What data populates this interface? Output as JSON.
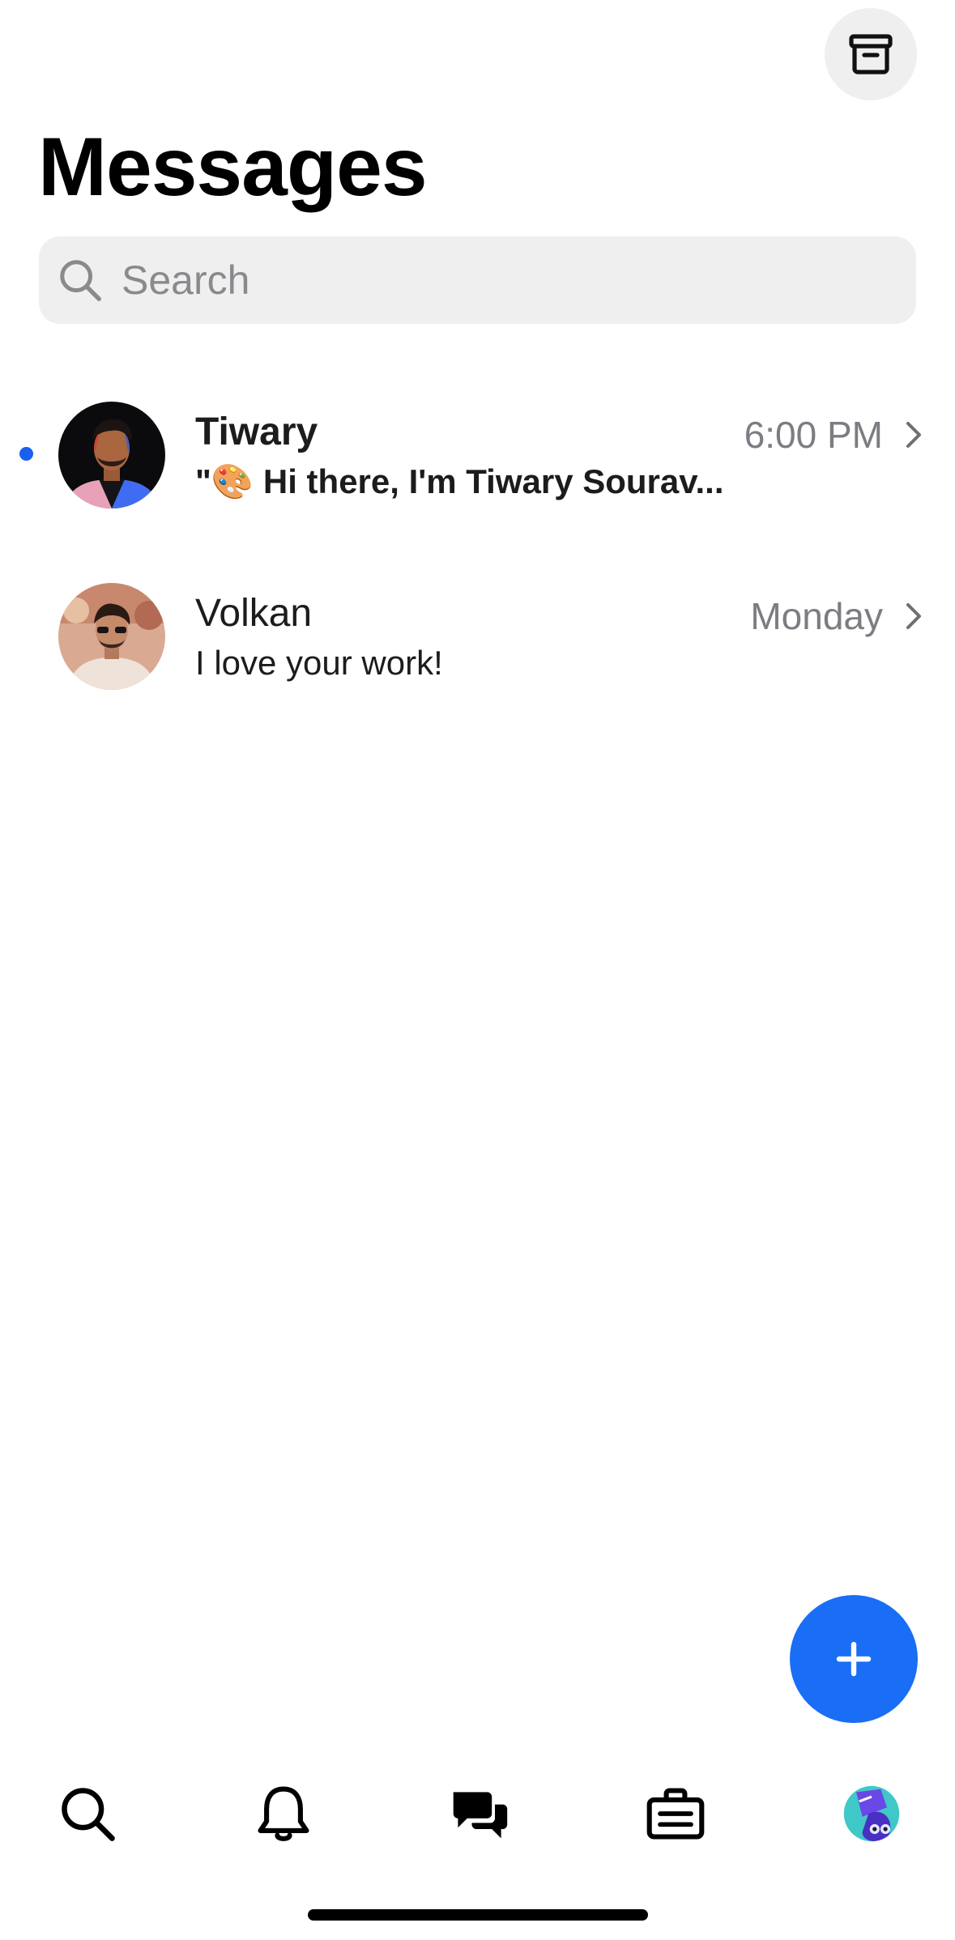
{
  "header": {
    "title": "Messages",
    "archive_icon": "archive-box-icon"
  },
  "search": {
    "placeholder": "Search",
    "value": ""
  },
  "conversations": [
    {
      "name": "Tiwary",
      "preview": "\"🎨 Hi there, I'm Tiwary Sourav...",
      "time": "6:00 PM",
      "unread": true
    },
    {
      "name": "Volkan",
      "preview": "I love your work!",
      "time": "Monday",
      "unread": false
    }
  ],
  "fab": {
    "icon": "plus-icon"
  },
  "tabbar": {
    "items": [
      {
        "id": "search",
        "icon": "magnifier-icon"
      },
      {
        "id": "notifications",
        "icon": "bell-icon"
      },
      {
        "id": "messages",
        "icon": "chat-bubbles-icon",
        "active": true
      },
      {
        "id": "jobs",
        "icon": "briefcase-icon"
      },
      {
        "id": "profile",
        "icon": "avatar-icon"
      }
    ]
  },
  "colors": {
    "accent": "#1a6ef5",
    "unread_dot": "#1a5ff0",
    "search_bg": "#efefef",
    "secondary_text": "#7c7c82"
  }
}
